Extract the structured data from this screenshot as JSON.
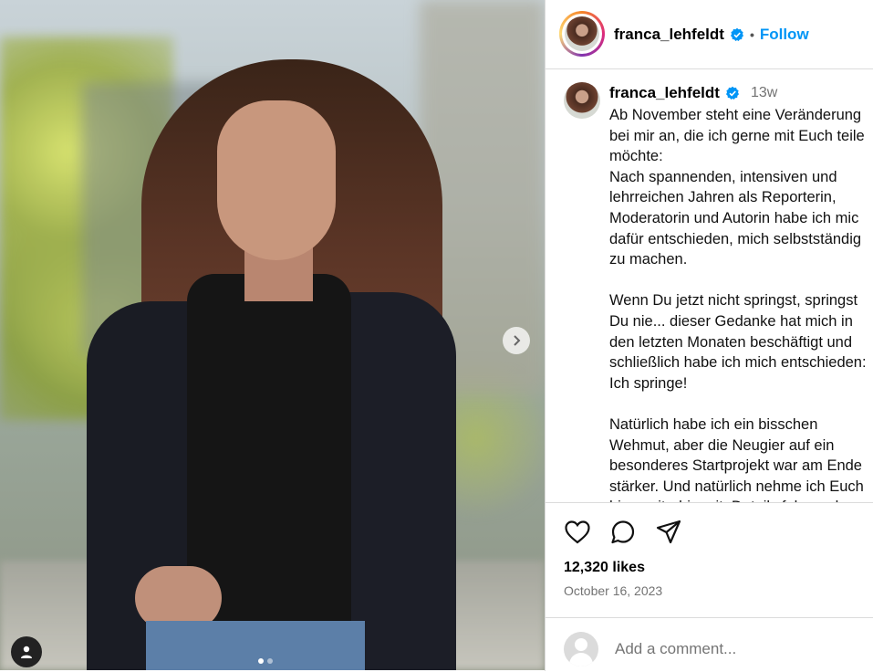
{
  "post": {
    "username": "franca_lehfeldt",
    "follow_label": "Follow",
    "separator": "•",
    "time_ago": "13w",
    "caption": "Ab November steht eine Veränderung\nbei mir an, die ich gerne mit Euch teile\nmöchte:\n Nach spannenden, intensiven und\nlehrreichen Jahren als Reporterin,\nModeratorin und Autorin habe ich mic\ndafür entschieden, mich selbstständig\nzu machen.\n\nWenn Du jetzt nicht springst, springst\nDu nie... dieser Gedanke hat mich in\nden letzten Monaten beschäftigt und\nschließlich habe ich mich entschieden:\nIch springe!\n\nNatürlich habe ich ein bisschen\nWehmut, aber die Neugier auf ein\nbesonderes Startprojekt war am Ende\nstärker. Und natürlich nehme ich Euch\nhier weiterhin mit. Details folgen also",
    "likes": "12,320 likes",
    "date": "October 16, 2023",
    "comment_placeholder": "Add a comment..."
  },
  "carousel": {
    "slides": 2,
    "current": 1
  },
  "icons": {
    "verified": "verified-badge-icon",
    "like": "heart-icon",
    "comment": "comment-icon",
    "share": "send-icon",
    "next": "chevron-right-icon",
    "tag": "user-tag-icon"
  },
  "colors": {
    "accent": "#0095f6",
    "verified": "#0095f6",
    "muted": "#737373",
    "border": "#dbdbdb"
  }
}
